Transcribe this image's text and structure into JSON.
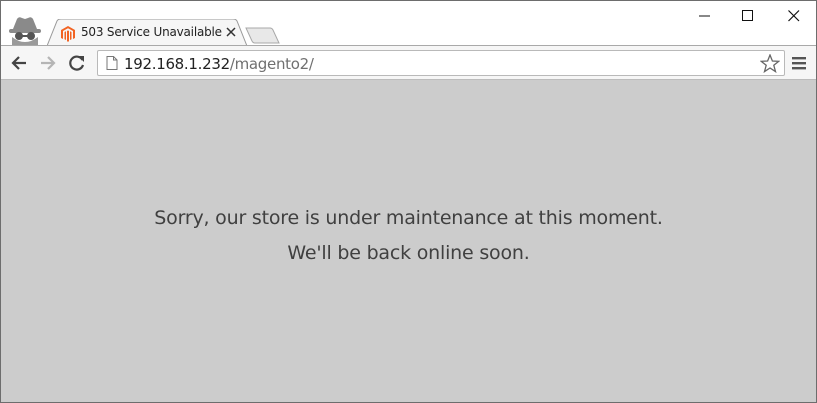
{
  "browser": {
    "mode_icon": "incognito-icon",
    "tab": {
      "title": "503 Service Unavailable",
      "favicon": "magento-logo-icon",
      "favicon_color": "#f26322"
    },
    "window_controls": {
      "minimize_icon": "minimize-icon",
      "maximize_icon": "maximize-icon",
      "close_icon": "close-icon"
    },
    "toolbar": {
      "back_icon": "arrow-left-icon",
      "forward_icon": "arrow-right-icon",
      "reload_icon": "reload-icon",
      "page_icon": "page-icon",
      "bookmark_icon": "star-icon",
      "menu_icon": "hamburger-menu-icon"
    },
    "address_bar": {
      "host": "192.168.1.232",
      "path": "/magento2/"
    }
  },
  "page": {
    "background_color": "#cccccc",
    "message_line1": "Sorry, our store is under maintenance at this moment.",
    "message_line2": "We'll be back online soon."
  }
}
